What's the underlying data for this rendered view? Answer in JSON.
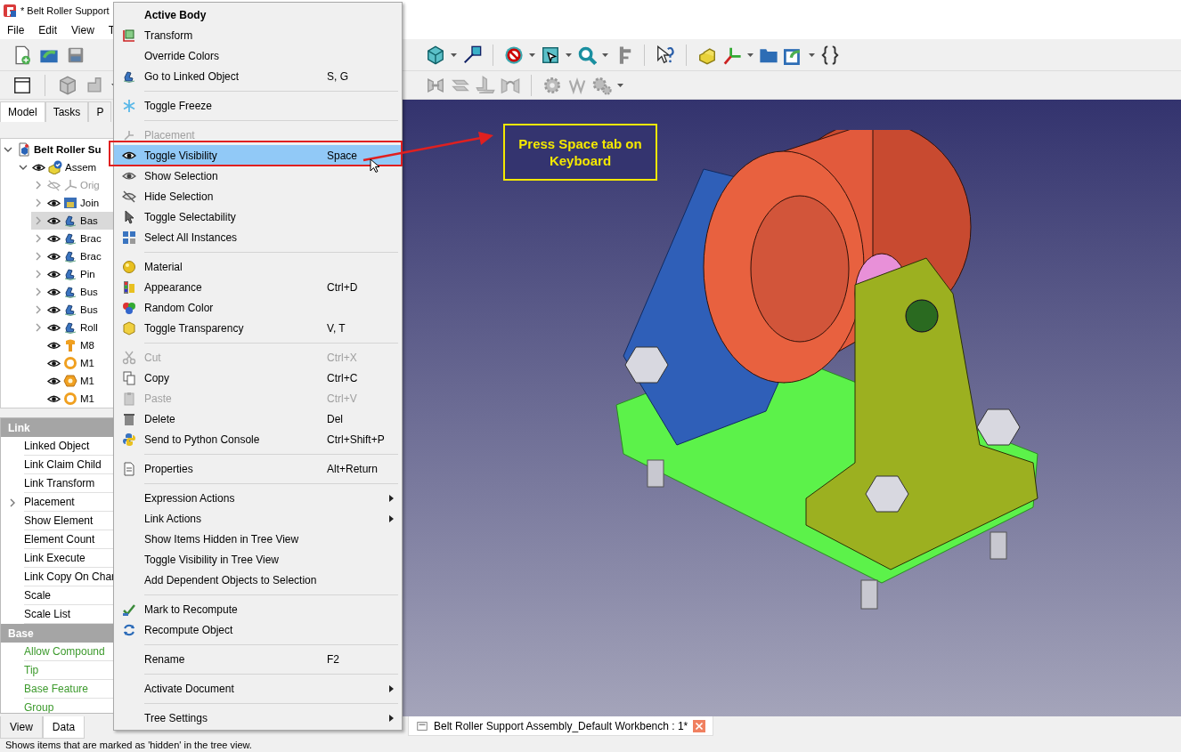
{
  "window": {
    "title": "* Belt Roller Support"
  },
  "menubar": [
    "File",
    "Edit",
    "View",
    "T"
  ],
  "combo_view": {
    "tabs": [
      {
        "label": "Model",
        "selected": true
      },
      {
        "label": "Tasks",
        "selected": false
      },
      {
        "label": "P",
        "selected": false
      }
    ],
    "tree": [
      {
        "label": "Belt Roller Su",
        "kind": "document",
        "expanded": true,
        "selected": false,
        "children": [
          {
            "label": "Assem",
            "kind": "assembly",
            "visible": true,
            "expanded": true,
            "selected": false,
            "children": [
              {
                "label": "Orig",
                "kind": "origin",
                "visible": false,
                "expanded": false,
                "selected": false
              },
              {
                "label": "Join",
                "kind": "group",
                "visible": true,
                "expanded": false,
                "selected": false
              },
              {
                "label": "Bas",
                "kind": "link",
                "visible": true,
                "expanded": false,
                "selected": true
              },
              {
                "label": "Brac",
                "kind": "link",
                "visible": true,
                "expanded": false,
                "selected": false
              },
              {
                "label": "Brac",
                "kind": "link",
                "visible": true,
                "expanded": false,
                "selected": false
              },
              {
                "label": "Pin",
                "kind": "link",
                "visible": true,
                "expanded": false,
                "selected": false
              },
              {
                "label": "Bus",
                "kind": "link",
                "visible": true,
                "expanded": false,
                "selected": false
              },
              {
                "label": "Bus",
                "kind": "link",
                "visible": true,
                "expanded": false,
                "selected": false
              },
              {
                "label": "Roll",
                "kind": "link",
                "visible": true,
                "expanded": false,
                "selected": false
              },
              {
                "label": "M8",
                "kind": "bolt",
                "visible": true,
                "selected": false
              },
              {
                "label": "M1",
                "kind": "washer",
                "visible": true,
                "selected": false
              },
              {
                "label": "M1",
                "kind": "nut",
                "visible": true,
                "selected": false
              },
              {
                "label": "M1",
                "kind": "washer",
                "visible": true,
                "selected": false
              }
            ]
          }
        ]
      }
    ],
    "properties": {
      "groups": [
        {
          "name": "Link",
          "rows": [
            {
              "label": "Linked Object"
            },
            {
              "label": "Link Claim Child"
            },
            {
              "label": "Link Transform"
            },
            {
              "label": "Placement",
              "expanded": false
            },
            {
              "label": "Show Element"
            },
            {
              "label": "Element Count"
            },
            {
              "label": "Link Execute"
            },
            {
              "label": "Link Copy On Char"
            },
            {
              "label": "Scale"
            },
            {
              "label": "Scale List"
            }
          ]
        },
        {
          "name": "Base",
          "rows": [
            {
              "label": "Allow Compound",
              "color": "#3c9a2c"
            },
            {
              "label": "Tip",
              "color": "#3c9a2c"
            },
            {
              "label": "Base Feature",
              "color": "#3c9a2c"
            },
            {
              "label": "Group",
              "color": "#3c9a2c"
            }
          ]
        }
      ]
    },
    "bottom_tabs": [
      {
        "label": "View",
        "selected": false
      },
      {
        "label": "Data",
        "selected": true
      }
    ]
  },
  "context_menu": {
    "items": [
      {
        "kind": "header",
        "label": "Active Body"
      },
      {
        "kind": "item",
        "label": "Transform"
      },
      {
        "kind": "item",
        "label": "Override Colors"
      },
      {
        "kind": "item",
        "label": "Go to Linked Object",
        "shortcut": "S, G"
      },
      {
        "kind": "separator"
      },
      {
        "kind": "item",
        "label": "Toggle Freeze"
      },
      {
        "kind": "separator"
      },
      {
        "kind": "item",
        "label": "Placement",
        "disabled": true
      },
      {
        "kind": "item",
        "label": "Toggle Visibility",
        "shortcut": "Space",
        "selected": true
      },
      {
        "kind": "item",
        "label": "Show Selection"
      },
      {
        "kind": "item",
        "label": "Hide Selection"
      },
      {
        "kind": "item",
        "label": "Toggle Selectability"
      },
      {
        "kind": "item",
        "label": "Select All Instances"
      },
      {
        "kind": "separator"
      },
      {
        "kind": "item",
        "label": "Material"
      },
      {
        "kind": "item",
        "label": "Appearance",
        "shortcut": "Ctrl+D"
      },
      {
        "kind": "item",
        "label": "Random Color"
      },
      {
        "kind": "item",
        "label": "Toggle Transparency",
        "shortcut": "V, T"
      },
      {
        "kind": "separator"
      },
      {
        "kind": "item",
        "label": "Cut",
        "shortcut": "Ctrl+X",
        "disabled": true
      },
      {
        "kind": "item",
        "label": "Copy",
        "shortcut": "Ctrl+C"
      },
      {
        "kind": "item",
        "label": "Paste",
        "shortcut": "Ctrl+V",
        "disabled": true
      },
      {
        "kind": "item",
        "label": "Delete",
        "shortcut": "Del"
      },
      {
        "kind": "item",
        "label": "Send to Python Console",
        "shortcut": "Ctrl+Shift+P"
      },
      {
        "kind": "separator"
      },
      {
        "kind": "item",
        "label": "Properties",
        "shortcut": "Alt+Return"
      },
      {
        "kind": "separator"
      },
      {
        "kind": "item",
        "label": "Expression Actions",
        "submenu": true
      },
      {
        "kind": "item",
        "label": "Link Actions",
        "submenu": true
      },
      {
        "kind": "item",
        "label": "Show Items Hidden in Tree View"
      },
      {
        "kind": "item",
        "label": "Toggle Visibility in Tree View"
      },
      {
        "kind": "item",
        "label": "Add Dependent Objects to Selection"
      },
      {
        "kind": "separator"
      },
      {
        "kind": "item",
        "label": "Mark to Recompute"
      },
      {
        "kind": "item",
        "label": "Recompute Object"
      },
      {
        "kind": "separator"
      },
      {
        "kind": "item",
        "label": "Rename",
        "shortcut": "F2"
      },
      {
        "kind": "separator"
      },
      {
        "kind": "item",
        "label": "Activate Document",
        "submenu": true
      },
      {
        "kind": "separator"
      },
      {
        "kind": "item",
        "label": "Tree Settings",
        "submenu": true
      }
    ]
  },
  "document_tab": {
    "title": "Belt Roller Support Assembly_Default Workbench : 1*"
  },
  "annotation": {
    "callout": "Press Space tab on Keyboard"
  },
  "status_bar": {
    "message": "Shows items that are marked as 'hidden' in the tree view."
  }
}
